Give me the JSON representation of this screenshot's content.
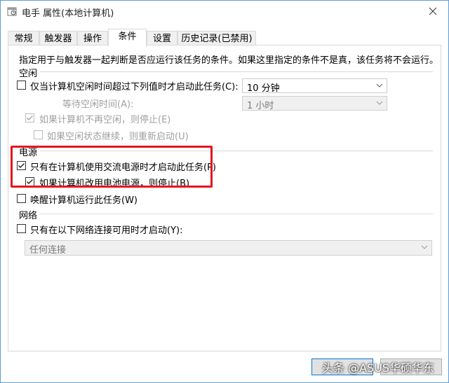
{
  "window": {
    "title": "电手 属性(本地计算机)"
  },
  "tabs": [
    {
      "label": "常规"
    },
    {
      "label": "触发器"
    },
    {
      "label": "操作"
    },
    {
      "label": "条件"
    },
    {
      "label": "设置"
    },
    {
      "label": "历史记录(已禁用)"
    }
  ],
  "active_tab": "条件",
  "description": "指定用于与触发器一起判断是否应运行该任务的条件。如果这里指定的条件不是真，该任务将不会运行。",
  "idle": {
    "section_label": "空闲",
    "start_if_idle": {
      "label": "仅当计算机空闲时间超过下列值时才启动此任务(C):",
      "checked": false,
      "combo_value": "10 分钟"
    },
    "wait_for_idle": {
      "label": "等待空闲时间(A):",
      "combo_value": "1 小时"
    },
    "stop_if_not_idle": {
      "label": "如果计算机不再空闲，则停止(E)",
      "checked": true,
      "disabled": true
    },
    "restart_if_idle_resumes": {
      "label": "如果空闲状态继续，则重新启动(U)",
      "checked": false,
      "disabled": true
    }
  },
  "power": {
    "section_label": "电源",
    "start_only_on_ac": {
      "label": "只有在计算机使用交流电源时才启动此任务(P)",
      "checked": true
    },
    "stop_if_on_battery": {
      "label": "如果计算机改用电池电源，则停止(B)",
      "checked": true
    },
    "wake_to_run": {
      "label": "唤醒计算机运行此任务(W)",
      "checked": false
    }
  },
  "network": {
    "section_label": "网络",
    "start_only_if_network": {
      "label": "只有在以下网络连接可用时才启动(Y):",
      "checked": false
    },
    "connection_combo": {
      "value": "任何连接"
    }
  },
  "watermark": "头条 @ASUS华硕华东",
  "colors": {
    "highlight": "#e4161f",
    "accent": "#0078d7",
    "disabled_text": "#a0a0a0"
  }
}
